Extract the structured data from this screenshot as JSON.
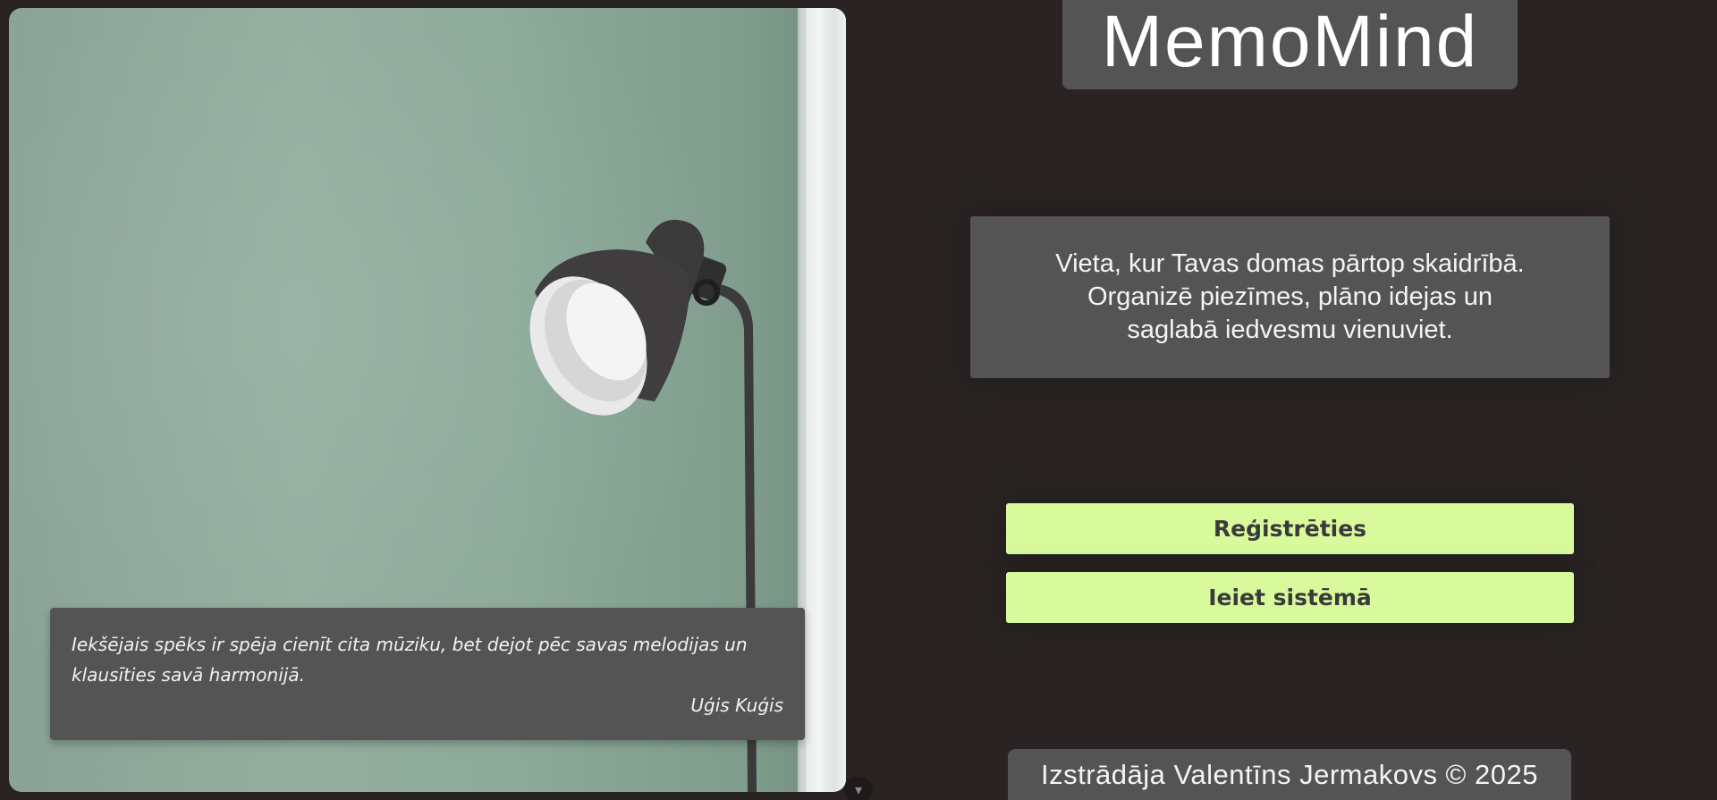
{
  "brand": {
    "name": "MemoMind"
  },
  "hero": {
    "tagline": "Vieta, kur Tavas domas pārtop skaidrībā. Organizē piezīmes, plāno idejas un saglabā iedvesmu vienuviet."
  },
  "quote": {
    "text": "Iekšējais spēks ir spēja cienīt cita mūziku, bet dejot pēc savas melodijas un klausīties savā harmonijā.",
    "author": "Uģis Kuģis"
  },
  "actions": {
    "register_label": "Reģistrēties",
    "login_label": "Ieiet sistēmā"
  },
  "footer": {
    "credit": "Izstrādāja Valentīns Jermakovs © 2025"
  },
  "scroll_hint": {
    "icon": "chevron-down-icon",
    "glyph": "▾"
  },
  "colors": {
    "background": "#292423",
    "panel": "#545454",
    "accent": "#d8fa9c",
    "button_text": "#3a3a3a",
    "text": "#f4f4f4"
  }
}
